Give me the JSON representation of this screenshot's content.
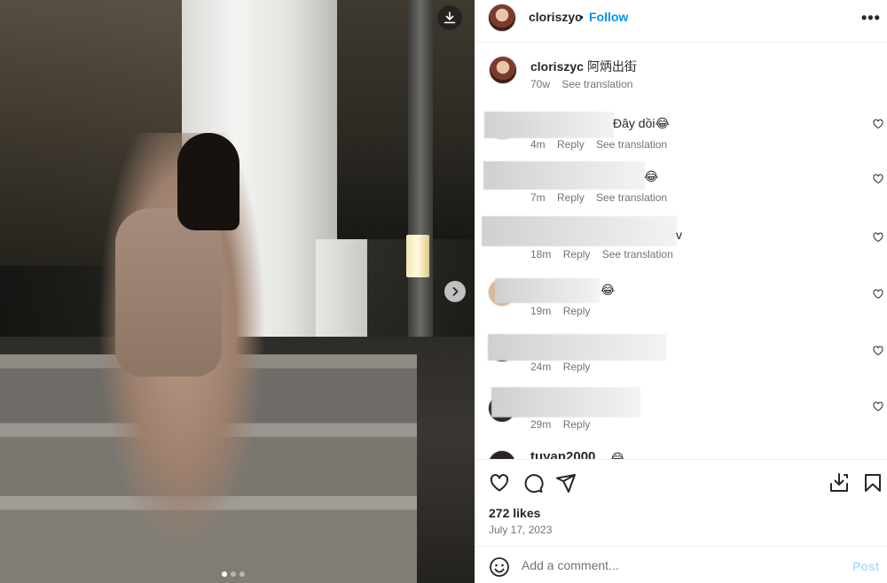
{
  "header": {
    "username": "cloriszyc",
    "separator": "•",
    "follow_label": "Follow",
    "more_label": "•••"
  },
  "photo": {
    "carousel_total": 3,
    "carousel_active": 1,
    "icons": {
      "download": "download-icon",
      "next": "chevron-right-icon"
    }
  },
  "caption": {
    "username": "cloriszyc",
    "text": "阿炳出街",
    "age": "70w",
    "see_translation": "See translation"
  },
  "comments": [
    {
      "text": "Đây dồi😂",
      "time": "4m",
      "reply": "Reply",
      "translate": "See translation"
    },
    {
      "text": "😂",
      "time": "7m",
      "reply": "Reply",
      "translate": "See translation"
    },
    {
      "text": "v",
      "time": "18m",
      "reply": "Reply",
      "translate": "See translation"
    },
    {
      "text": "😂",
      "time": "19m",
      "reply": "Reply",
      "translate": ""
    },
    {
      "text": "",
      "time": "24m",
      "reply": "Reply",
      "translate": ""
    },
    {
      "text": "",
      "time": "29m",
      "reply": "Reply",
      "translate": ""
    }
  ],
  "partial_comment": {
    "username": "tuyan2000",
    "text": "😂"
  },
  "actions": {
    "icons": [
      "heart-icon",
      "comment-icon",
      "share-icon",
      "save-to-collection-icon",
      "bookmark-icon"
    ],
    "likes": "272 likes",
    "date": "July 17, 2023"
  },
  "add_comment": {
    "placeholder": "Add a comment...",
    "post_label": "Post",
    "emoji_icon": "emoji-icon"
  },
  "colors": {
    "link_blue": "#0095f6",
    "disabled_post": "#b2dffc",
    "muted_text": "#737373"
  }
}
